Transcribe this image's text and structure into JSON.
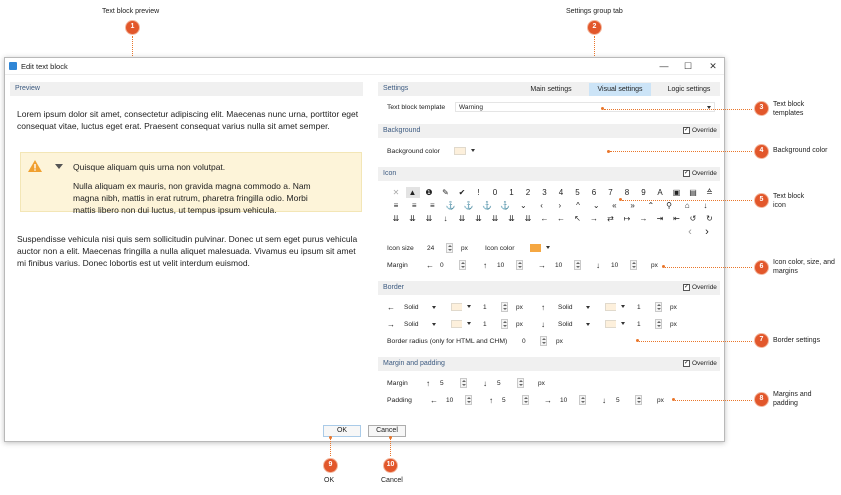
{
  "annotations": [
    {
      "n": "1",
      "text": "Text block preview"
    },
    {
      "n": "2",
      "text": "Settings group tab"
    },
    {
      "n": "3",
      "text": "Text block templates"
    },
    {
      "n": "4",
      "text": "Background color"
    },
    {
      "n": "5",
      "text": "Text block icon"
    },
    {
      "n": "6",
      "text": "Icon color, size, and margins"
    },
    {
      "n": "7",
      "text": "Border settings"
    },
    {
      "n": "8",
      "text": "Margins and padding"
    },
    {
      "n": "9",
      "text": "OK"
    },
    {
      "n": "10",
      "text": "Cancel"
    }
  ],
  "window": {
    "title": "Edit text block",
    "minimize": "—",
    "maximize": "☐",
    "close": "✕"
  },
  "preview": {
    "header": "Preview",
    "p1": "Lorem ipsum dolor sit amet, consectetur adipiscing elit. Maecenas nunc urna, porttitor eget consequat vitae, luctus eget erat. Praesent consequat varius nulla sit amet semper.",
    "callout_title": "Quisque aliquam quis urna non volutpat.",
    "callout_body": "Nulla aliquam ex mauris, non gravida magna commodo a. Nam magna nibh, mattis in erat rutrum, pharetra fringilla odio. Morbi mattis libero non dui luctus, ut tempus ipsum vehicula.",
    "p2": "Suspendisse vehicula nisi quis sem sollicitudin pulvinar. Donec ut sem eget purus vehicula auctor non a elit. Maecenas fringilla a nulla aliquet malesuada. Vivamus eu ipsum sit amet mi finibus varius. Donec lobortis est ut velit interdum euismod."
  },
  "settings": {
    "header": "Settings",
    "tabs": [
      {
        "label": "Main settings"
      },
      {
        "label": "Visual settings"
      },
      {
        "label": "Logic settings"
      }
    ],
    "template_label": "Text block template",
    "template_value": "Warning",
    "background": {
      "header": "Background",
      "override": "Override",
      "color_label": "Background color"
    },
    "icon": {
      "header": "Icon",
      "override": "Override",
      "row1": [
        "✕",
        "▲",
        "❶",
        "✎",
        "✔",
        "!",
        "0",
        "1",
        "2",
        "3",
        "4",
        "5",
        "6",
        "7",
        "8",
        "9",
        "A",
        "▣",
        "▤",
        "≙"
      ],
      "row2": [
        "≡",
        "≡",
        "≡",
        "⚓",
        "⚓",
        "⚓",
        "⚓",
        "⌄",
        "‹",
        "›",
        "^",
        "⌄",
        "«",
        "»",
        "⌃",
        "⚲",
        "⌂",
        "↓"
      ],
      "row3": [
        "⇊",
        "⇊",
        "⇊",
        "↓",
        "⇊",
        "⇊",
        "⇊",
        "⇊",
        "⇊",
        "←",
        "←",
        "↖",
        "→",
        "⇄",
        "↦",
        "→",
        "⇥",
        "⇤",
        "↺",
        "↻"
      ],
      "nav_prev": "‹",
      "nav_next": "›",
      "size_label": "Icon size",
      "size_value": "24",
      "size_unit": "px",
      "color_label": "Icon color",
      "margin_label": "Margin",
      "m_left": "0",
      "m_top": "10",
      "m_right": "10",
      "m_bottom": "10",
      "m_unit": "px"
    },
    "border": {
      "header": "Border",
      "override": "Override",
      "left": {
        "style": "Solid",
        "width": "1",
        "unit": "px"
      },
      "top": {
        "style": "Solid",
        "width": "1",
        "unit": "px"
      },
      "right": {
        "style": "Solid",
        "width": "1",
        "unit": "px"
      },
      "bottom": {
        "style": "Solid",
        "width": "1",
        "unit": "px"
      },
      "radius_label": "Border radius (only for HTML and CHM)",
      "radius_value": "0",
      "radius_unit": "px"
    },
    "margin_padding": {
      "header": "Margin and padding",
      "override": "Override",
      "margin_label": "Margin",
      "m_top": "5",
      "m_bottom": "5",
      "m_unit": "px",
      "padding_label": "Padding",
      "p_left": "10",
      "p_top": "5",
      "p_right": "10",
      "p_bottom": "5",
      "p_unit": "px"
    }
  },
  "buttons": {
    "ok": "OK",
    "cancel": "Cancel"
  },
  "colors": {
    "badge": "#e2572b",
    "tab_active": "#cce4f7",
    "callout_bg": "#fdf4d9",
    "warning_icon": "#f0a030",
    "icon_color": "#f5a742"
  }
}
